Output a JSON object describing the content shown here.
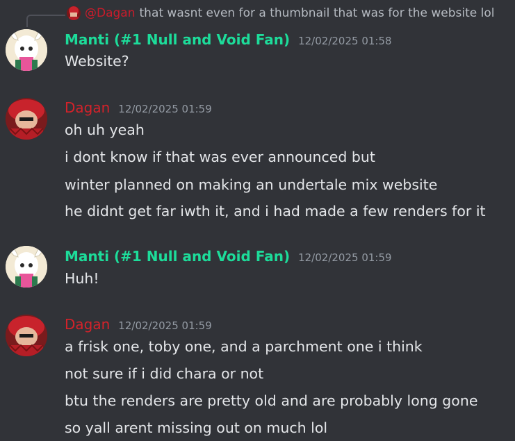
{
  "reply": {
    "mention": "@Dagan",
    "text": "that wasnt even for a thumbnail that was for the website lol"
  },
  "messages": [
    {
      "author": "Manti (#1 Null and Void Fan)",
      "timestamp": "12/02/2025 01:58",
      "name_color": "#1ddc9a",
      "lines": [
        "Website?"
      ]
    },
    {
      "author": "Dagan",
      "timestamp": "12/02/2025 01:59",
      "name_color": "#d4222a",
      "lines": [
        "oh uh yeah",
        "i dont know if that was ever announced but",
        "winter planned on making an undertale mix website",
        "he didnt get far iwth it, and i had made a few renders for it"
      ]
    },
    {
      "author": "Manti (#1 Null and Void Fan)",
      "timestamp": "12/02/2025 01:59",
      "name_color": "#1ddc9a",
      "lines": [
        "Huh!"
      ]
    },
    {
      "author": "Dagan",
      "timestamp": "12/02/2025 01:59",
      "name_color": "#d4222a",
      "lines": [
        "a frisk one, toby one, and a parchment one i think",
        "not sure if i did chara or not",
        "btu the renders are pretty old and are probably long gone",
        "so yall arent missing out on much lol"
      ]
    }
  ]
}
